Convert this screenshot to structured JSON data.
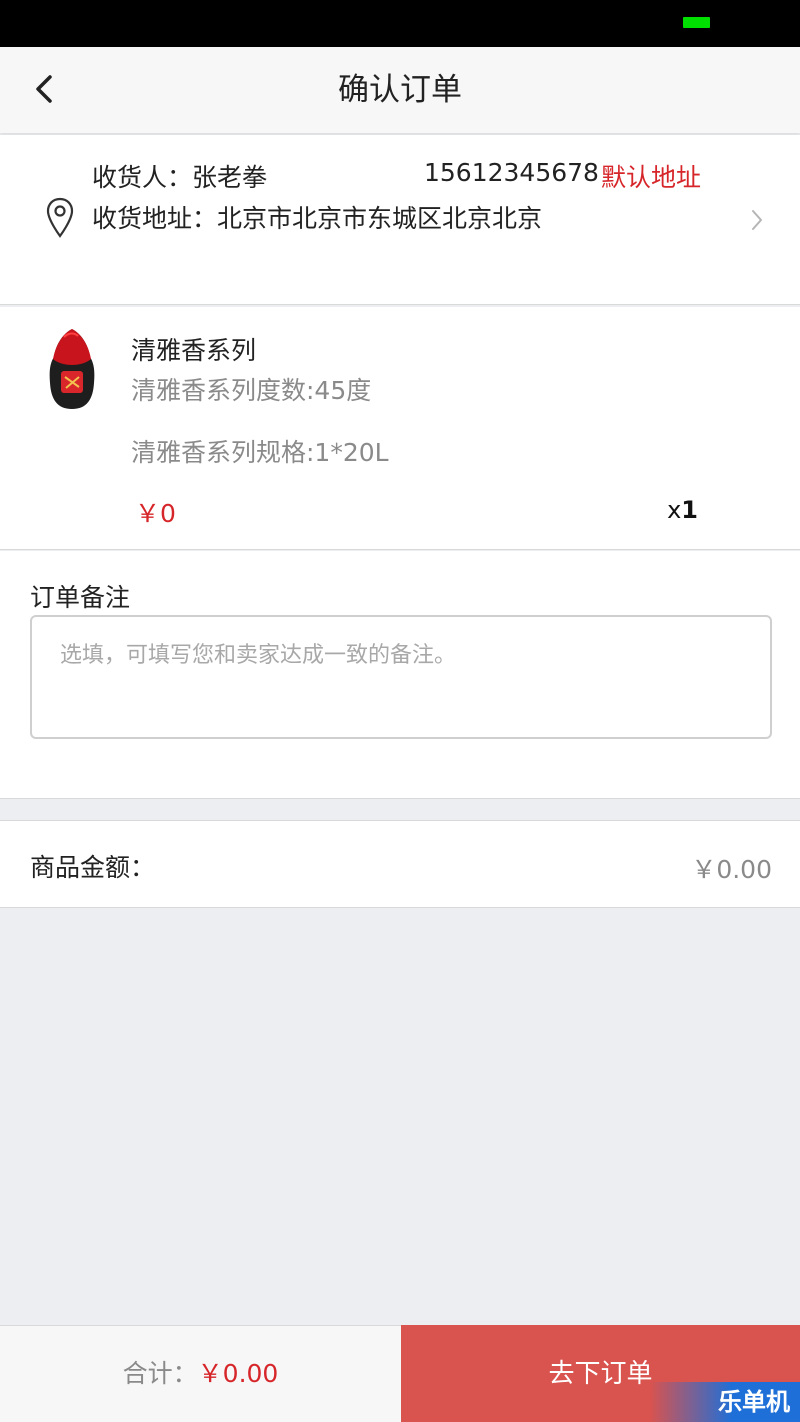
{
  "header": {
    "title": "确认订单"
  },
  "address": {
    "consignee": "收货人：张老拳",
    "phone": "15612345678",
    "default_tag": "默认地址",
    "address_line": "收货地址：北京市北京市东城区北京北京"
  },
  "product": {
    "name": "清雅香系列",
    "spec_degree": "清雅香系列度数:45度",
    "spec_size": "清雅香系列规格:1*20L",
    "price": "￥0",
    "qty_prefix": "x",
    "qty": "1"
  },
  "remark": {
    "label": "订单备注",
    "placeholder": "选填，可填写您和卖家达成一致的备注。"
  },
  "amount": {
    "label": "商品金额：",
    "value": "￥0.00"
  },
  "footer": {
    "total_label": "合计：",
    "total_value": "￥0.00",
    "submit_label": "去下订单"
  },
  "watermark": {
    "text": "乐单机"
  },
  "colors": {
    "accent_red": "#d6262a",
    "button_red": "#d9534f"
  }
}
